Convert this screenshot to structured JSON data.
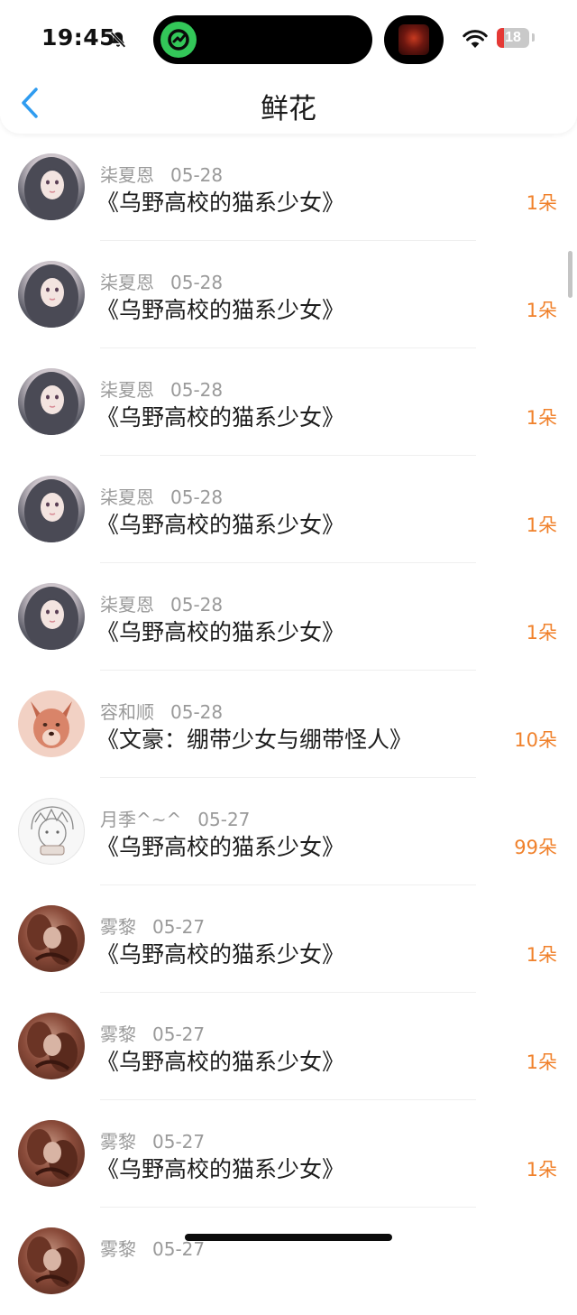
{
  "status_bar": {
    "time": "19:45",
    "battery_level": "18",
    "battery_color": "#e53935"
  },
  "nav": {
    "title": "鲜花",
    "accent": "#2f9cf0"
  },
  "amount_color": "#f0812b",
  "rows": [
    {
      "user": "柒夏恩",
      "date": "05-28",
      "title": "《乌野高校的猫系少女》",
      "amount": "1朵",
      "avatar": "girl-avatar"
    },
    {
      "user": "柒夏恩",
      "date": "05-28",
      "title": "《乌野高校的猫系少女》",
      "amount": "1朵",
      "avatar": "girl-avatar"
    },
    {
      "user": "柒夏恩",
      "date": "05-28",
      "title": "《乌野高校的猫系少女》",
      "amount": "1朵",
      "avatar": "girl-avatar"
    },
    {
      "user": "柒夏恩",
      "date": "05-28",
      "title": "《乌野高校的猫系少女》",
      "amount": "1朵",
      "avatar": "girl-avatar"
    },
    {
      "user": "柒夏恩",
      "date": "05-28",
      "title": "《乌野高校的猫系少女》",
      "amount": "1朵",
      "avatar": "girl-avatar"
    },
    {
      "user": "容和顺",
      "date": "05-28",
      "title": "《文豪：绷带少女与绷带怪人》",
      "amount": "10朵",
      "avatar": "fox-avatar"
    },
    {
      "user": "月季^~^",
      "date": "05-27",
      "title": "《乌野高校的猫系少女》",
      "amount": "99朵",
      "avatar": "sketch-avatar"
    },
    {
      "user": "雾黎",
      "date": "05-27",
      "title": "《乌野高校的猫系少女》",
      "amount": "1朵",
      "avatar": "brown-avatar"
    },
    {
      "user": "雾黎",
      "date": "05-27",
      "title": "《乌野高校的猫系少女》",
      "amount": "1朵",
      "avatar": "brown-avatar"
    },
    {
      "user": "雾黎",
      "date": "05-27",
      "title": "《乌野高校的猫系少女》",
      "amount": "1朵",
      "avatar": "brown-avatar"
    },
    {
      "user": "雾黎",
      "date": "05-27",
      "title": "",
      "amount": "",
      "avatar": "brown-avatar"
    }
  ]
}
